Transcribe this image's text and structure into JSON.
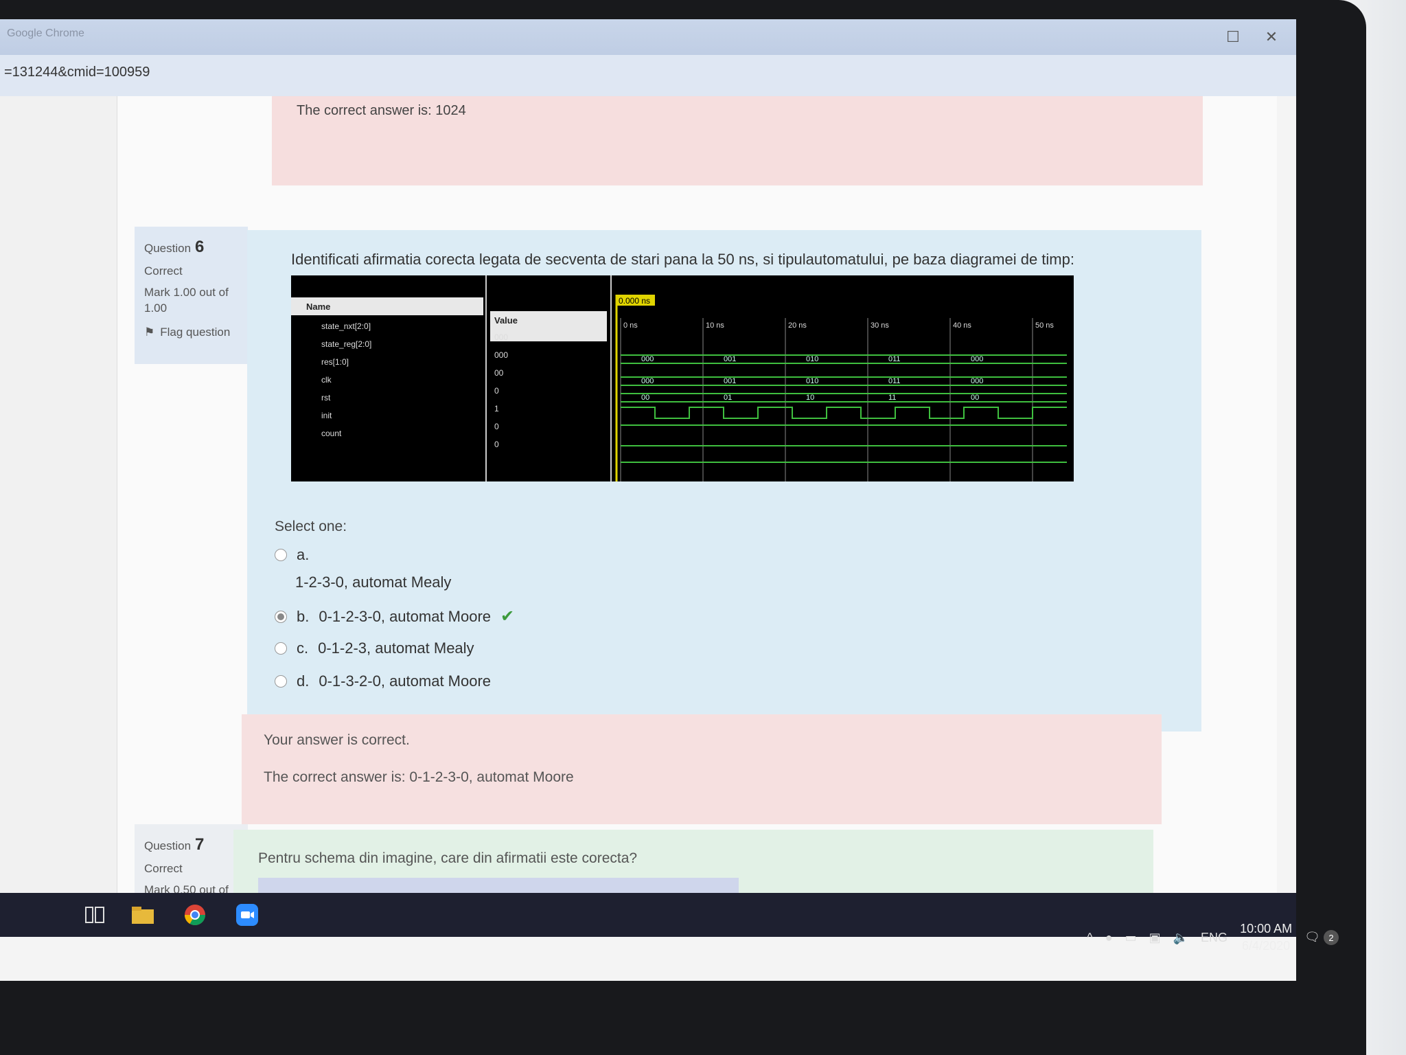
{
  "browser": {
    "app_title": "Google Chrome",
    "url": "=131244&cmid=100959",
    "controls": [
      "☐",
      "✕"
    ]
  },
  "previous_question": {
    "correct_answer": "The correct answer is: 1024"
  },
  "question6": {
    "label": "Question",
    "number": "6",
    "status": "Correct",
    "mark": "Mark 1.00 out of 1.00",
    "flag": "Flag question",
    "text": "Identificati afirmatia corecta legata de secventa de stari pana la 50 ns, si tipulautomatului,  pe baza diagramei de timp:",
    "select_one": "Select one:",
    "options": [
      {
        "letter": "a.",
        "text": "1-2-3-0, automat Mealy",
        "selected": false
      },
      {
        "letter": "b.",
        "text": "0-1-2-3-0, automat Moore",
        "selected": true
      },
      {
        "letter": "c.",
        "text": "0-1-2-3, automat Mealy",
        "selected": false
      },
      {
        "letter": "d.",
        "text": "0-1-3-2-0, automat Moore",
        "selected": false
      }
    ],
    "feedback": "Your answer is correct.",
    "correct_answer": "The correct answer is: 0-1-2-3-0, automat Moore"
  },
  "simulation": {
    "cursor": "0.000 ns",
    "name_header": "Name",
    "value_header": "Value",
    "signals": [
      {
        "name": "state_nxt[2:0]",
        "value": "000"
      },
      {
        "name": "state_reg[2:0]",
        "value": "000"
      },
      {
        "name": "res[1:0]",
        "value": "00"
      },
      {
        "name": "clk",
        "value": "0"
      },
      {
        "name": "rst",
        "value": "1"
      },
      {
        "name": "init",
        "value": "0"
      },
      {
        "name": "count",
        "value": "0"
      }
    ],
    "time_ticks": [
      "0 ns",
      "10 ns",
      "20 ns",
      "30 ns",
      "40 ns",
      "50 ns"
    ],
    "bus_labels_row1": [
      "000",
      "001",
      "010",
      "011",
      "000"
    ],
    "bus_labels_row2": [
      "000",
      "001",
      "010",
      "011",
      "000"
    ],
    "bus_labels_row3": [
      "00",
      "01",
      "10",
      "11",
      "00"
    ]
  },
  "question7": {
    "label": "Question",
    "number": "7",
    "status": "Correct",
    "mark": "Mark 0.50 out of",
    "text": "Pentru schema din imagine, care din afirmatii este corecta?"
  },
  "taskbar": {
    "lang": "ENG",
    "time": "10:00 AM",
    "date": "6/4/2020",
    "notifications": "2"
  }
}
